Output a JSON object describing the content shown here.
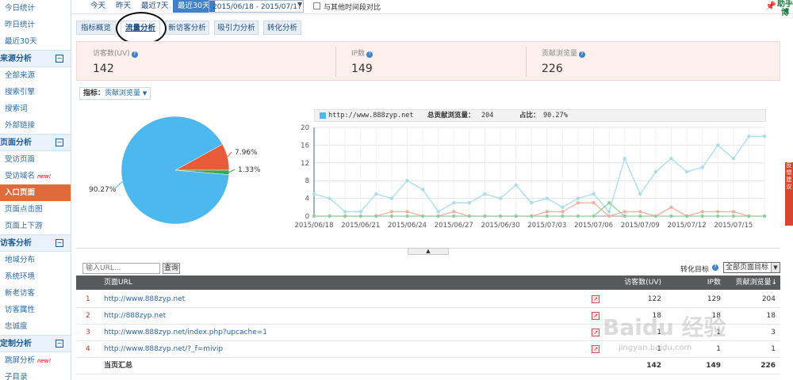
{
  "sidebar": {
    "items_top": [
      "今日统计",
      "昨日统计",
      "最近30天"
    ],
    "section_source": "来源分析",
    "source_items": [
      "全部来源",
      "搜索引擎",
      "搜索词",
      "外部链接"
    ],
    "section_page": "页面分析",
    "page_items": [
      "受访页面",
      "受访域名",
      "入口页面",
      "页面点击图",
      "页面上下游"
    ],
    "section_visitor": "访客分析",
    "visitor_items": [
      "地域分布",
      "系统环境",
      "新老访客",
      "访客属性",
      "忠诚度"
    ],
    "section_custom": "定制分析",
    "custom_items": [
      "跳屏分析",
      "子目录"
    ],
    "new_tag": "new!",
    "toggle": "⊟"
  },
  "topbar": {
    "today": "今天",
    "yesterday": "昨天",
    "last7": "最近7天",
    "last30": "最近30天",
    "date_range": "2015/06/18 - 2015/07/17",
    "compare_label": "与其他时间段对比",
    "right_strip": "助手博"
  },
  "tabs": [
    "指标概览",
    "流量分析",
    "新访客分析",
    "吸引力分析",
    "转化分析"
  ],
  "metrics": [
    {
      "label": "访客数(UV)",
      "value": "142"
    },
    {
      "label": "IP数",
      "value": "149"
    },
    {
      "label": "贡献浏览量",
      "value": "226"
    }
  ],
  "indicator": {
    "label": "指标：",
    "value": "贡献浏览量"
  },
  "chart_data": [
    {
      "type": "pie",
      "categories": [
        "http://www.888zyp.net",
        "",
        ""
      ],
      "values": [
        90.27,
        7.96,
        1.33
      ],
      "labels": [
        "90.27%",
        "7.96%",
        "1.33%"
      ],
      "colors": [
        "#4db8ee",
        "#e85b38",
        "#3aa84a"
      ]
    },
    {
      "type": "line",
      "legend": {
        "site": "http://www.888zyp.net",
        "total_label": "总贡献浏览量：",
        "total_value": "204",
        "share_label": "占比：",
        "share_value": "90.27%"
      },
      "x": [
        "2015/06/18",
        "2015/06/19",
        "2015/06/20",
        "2015/06/21",
        "2015/06/22",
        "2015/06/23",
        "2015/06/24",
        "2015/06/25",
        "2015/06/26",
        "2015/06/27",
        "2015/06/28",
        "2015/06/29",
        "2015/06/30",
        "2015/07/01",
        "2015/07/02",
        "2015/07/03",
        "2015/07/04",
        "2015/07/05",
        "2015/07/06",
        "2015/07/07",
        "2015/07/08",
        "2015/07/09",
        "2015/07/10",
        "2015/07/11",
        "2015/07/12",
        "2015/07/13",
        "2015/07/14",
        "2015/07/15",
        "2015/07/16",
        "2015/07/17"
      ],
      "x_tick_labels": [
        "2015/06/18",
        "2015/06/21",
        "2015/06/24",
        "2015/06/27",
        "2015/06/30",
        "2015/07/03",
        "2015/07/06",
        "2015/07/09",
        "2015/07/12",
        "2015/07/15"
      ],
      "yticks": [
        0,
        4,
        8,
        12,
        16,
        20
      ],
      "ylim": [
        0,
        20
      ],
      "series": [
        {
          "color": "#a9dcef",
          "values": [
            5,
            4,
            1,
            1,
            5,
            4,
            8,
            6,
            1,
            3,
            3,
            5,
            4,
            7,
            3,
            4,
            2,
            4,
            5,
            1,
            13,
            5,
            10,
            13,
            10,
            11,
            16,
            13,
            18,
            18
          ]
        },
        {
          "color": "#f3b0a0",
          "values": [
            0,
            0,
            0,
            0,
            0,
            1,
            1,
            0,
            0,
            1,
            0,
            0,
            0,
            0,
            0,
            1,
            1,
            3,
            3,
            0,
            1,
            1,
            0,
            2,
            0,
            1,
            1,
            1,
            0,
            0
          ]
        },
        {
          "color": "#8fd19e",
          "values": [
            0,
            0,
            0,
            0,
            0,
            0,
            0,
            0,
            0,
            0,
            0,
            0,
            0,
            0,
            0,
            0,
            0,
            0,
            0,
            3,
            0,
            0,
            0,
            0,
            0,
            0,
            0,
            0,
            0,
            0
          ]
        }
      ]
    }
  ],
  "search": {
    "placeholder": "输入URL...",
    "button": "查询"
  },
  "conversion": {
    "label": "转化目标",
    "select": "全部页面目标"
  },
  "table": {
    "headers": {
      "url": "页面URL",
      "uv": "访客数(UV)",
      "ip": "IP数",
      "pv": "贡献浏览量"
    },
    "rows": [
      {
        "idx": "1",
        "url": "http://www.888zyp.net",
        "uv": "122",
        "ip": "129",
        "pv": "204"
      },
      {
        "idx": "2",
        "url": "http://888zyp.net",
        "uv": "18",
        "ip": "18",
        "pv": "18"
      },
      {
        "idx": "3",
        "url": "http://www.888zyp.net/index.php?upcache=1",
        "uv": "1",
        "ip": "1",
        "pv": "3"
      },
      {
        "idx": "4",
        "url": "http://www.888zyp.net/?_f=mivip",
        "uv": "1",
        "ip": "1",
        "pv": "1"
      }
    ],
    "summary": {
      "label": "当页汇总",
      "uv": "142",
      "ip": "149",
      "pv": "226"
    }
  },
  "right_ad": "反馈建议",
  "watermark": {
    "main": "Baidu 经验",
    "sub": "jingyan.baidu.com"
  }
}
